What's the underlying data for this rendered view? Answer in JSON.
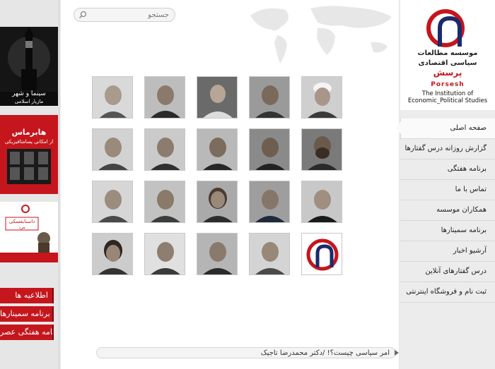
{
  "search": {
    "placeholder": "جستجو"
  },
  "left_buttons": [
    {
      "label": "اطلاعیه ها"
    },
    {
      "label": "برنامه سمینارها"
    },
    {
      "label": "برنامه هفتگی عصر"
    }
  ],
  "banners": [
    {
      "title": "سینما و شهر",
      "subtitle": "مازیار اسلامی"
    },
    {
      "title": "هابرماس",
      "subtitle": "از امکانی پسامتافیزیکی"
    },
    {
      "title": "داستایفسکی",
      "subtitle": "مرد"
    }
  ],
  "logo": {
    "fa_line1": "موسسه مطالعات",
    "fa_line2": "سیاسی اقتصادی",
    "fa_line3": "پرسش",
    "en_name": "Porsesh",
    "en_line1": "The Institution of",
    "en_line2": "Economic_Political Studies"
  },
  "nav": [
    {
      "label": "صفحه اصلی",
      "active": true
    },
    {
      "label": "گزارش روزانه درس گفتارها"
    },
    {
      "label": "برنامه هفتگی"
    },
    {
      "label": "تماس با ما"
    },
    {
      "label": "همکاران موسسه"
    },
    {
      "label": "برنامه سمینارها"
    },
    {
      "label": "آرشیو اخبار"
    },
    {
      "label": "درس گفتارهای آنلاین"
    },
    {
      "label": "ثبت نام و فروشگاه اینترنتی"
    }
  ],
  "ticker": {
    "text": "امر سیاسی چیست؟! /دکتر محمدرضا تاجیک"
  },
  "colors": {
    "brand_red": "#c4161c",
    "logo_blue": "#1b2a6b"
  }
}
